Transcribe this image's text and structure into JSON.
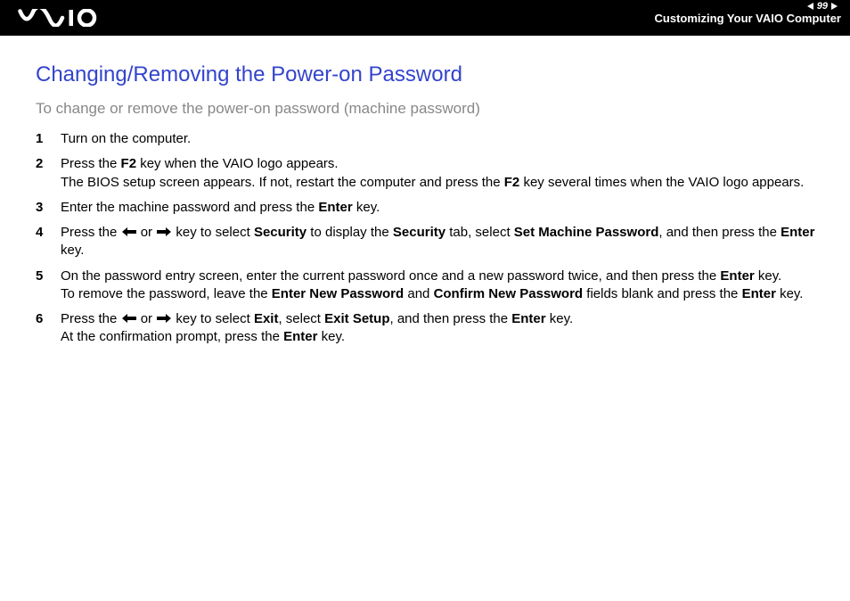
{
  "header": {
    "page_number": "99",
    "section_title": "Customizing Your VAIO Computer"
  },
  "main": {
    "heading": "Changing/Removing the Power-on Password",
    "subheading": "To change or remove the power-on password (machine password)",
    "steps": [
      {
        "num": "1",
        "html": "Turn on the computer."
      },
      {
        "num": "2",
        "html": "Press the <b>F2</b> key when the VAIO logo appears.<br>The BIOS setup screen appears. If not, restart the computer and press the <b>F2</b> key several times when the VAIO logo appears."
      },
      {
        "num": "3",
        "html": "Enter the machine password and press the <b>Enter</b> key."
      },
      {
        "num": "4",
        "html": "Press the {LEFT} or {RIGHT} key to select <b>Security</b> to display the <b>Security</b> tab, select <b>Set Machine Password</b>, and then press the <b>Enter</b> key."
      },
      {
        "num": "5",
        "html": "On the password entry screen, enter the current password once and a new password twice, and then press the <b>Enter</b> key.<br>To remove the password, leave the <b>Enter New Password</b> and <b>Confirm New Password</b> fields blank and press the <b>Enter</b> key."
      },
      {
        "num": "6",
        "html": "Press the {LEFT} or {RIGHT} key to select <b>Exit</b>, select <b>Exit Setup</b>, and then press the <b>Enter</b> key.<br>At the confirmation prompt, press the <b>Enter</b> key."
      }
    ]
  }
}
